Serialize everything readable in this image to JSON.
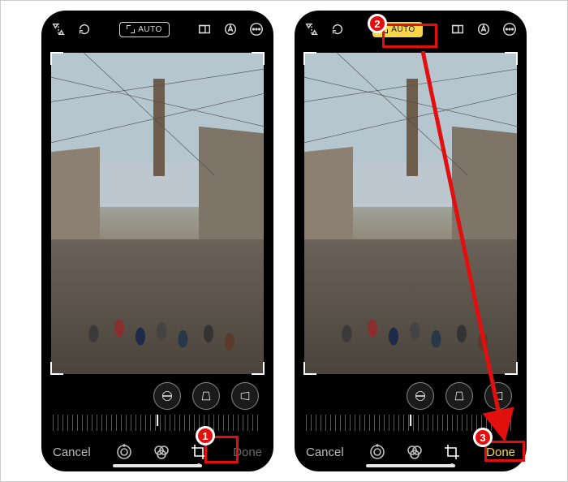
{
  "annotations": {
    "step1": "1",
    "step2": "2",
    "step3": "3"
  },
  "leftScreen": {
    "topbar": {
      "auto_label": "AUTO",
      "auto_active": false
    },
    "bottombar": {
      "cancel": "Cancel",
      "done": "Done",
      "active_mode": "crop"
    }
  },
  "rightScreen": {
    "topbar": {
      "auto_label": "AUTO",
      "auto_active": true
    },
    "bottombar": {
      "cancel": "Cancel",
      "done": "Done",
      "active_mode": "crop",
      "done_enabled": true
    }
  },
  "icons": {
    "flip_vertical": "flip-vertical-icon",
    "rotate": "rotate-icon",
    "aspect": "aspect-ratio-icon",
    "markup": "markup-icon",
    "more": "more-icon",
    "straighten": "straighten-icon",
    "horizontal_persp": "horizontal-perspective-icon",
    "vertical_persp": "vertical-perspective-icon",
    "mode_adjust": "adjust-mode-icon",
    "mode_filters": "filters-mode-icon",
    "mode_crop": "crop-mode-icon"
  }
}
